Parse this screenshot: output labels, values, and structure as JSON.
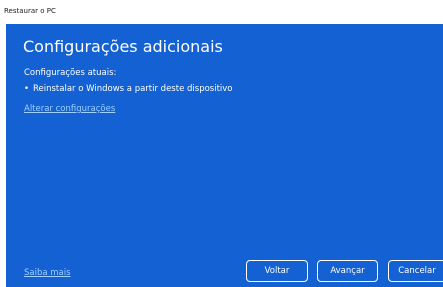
{
  "window": {
    "title": "Restaurar o PC"
  },
  "main": {
    "heading": "Configurações adicionais",
    "current_settings_label": "Configurações atuais:",
    "current_settings_items": [
      "Reinstalar o Windows a partir deste dispositivo"
    ],
    "change_settings_link": "Alterar configurações",
    "learn_more_link": "Saiba mais"
  },
  "buttons": {
    "back": "Voltar",
    "next": "Avançar",
    "cancel": "Cancelar"
  },
  "colors": {
    "panel_background": "#1361d2",
    "link": "#9fd0ff",
    "text": "#ffffff"
  }
}
